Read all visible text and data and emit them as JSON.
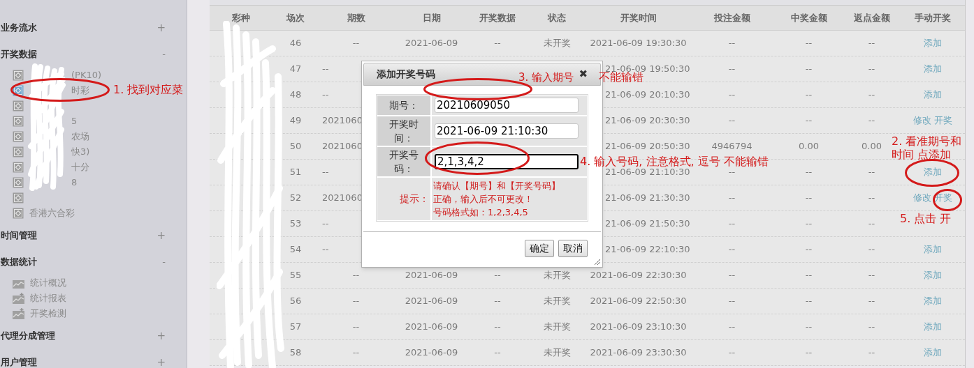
{
  "sidebar": {
    "groups": [
      {
        "title": "业务流水",
        "expanded": false,
        "toggle": "+"
      },
      {
        "title": "开奖数据",
        "expanded": true,
        "toggle": "-",
        "items": [
          {
            "label": "(PK10)",
            "selected": false,
            "kind": "redacted"
          },
          {
            "label": "时彩",
            "selected": true,
            "kind": "redacted"
          },
          {
            "selected": false,
            "kind": "redacted"
          },
          {
            "label": "5",
            "selected": false,
            "kind": "redacted"
          },
          {
            "label": "农场",
            "selected": false,
            "kind": "redacted"
          },
          {
            "label": "快3)",
            "selected": false,
            "kind": "redacted"
          },
          {
            "label": "十分",
            "selected": false,
            "kind": "redacted"
          },
          {
            "label": "8",
            "selected": false,
            "kind": "redacted"
          },
          {
            "selected": false,
            "kind": "redacted"
          },
          {
            "label": "香港六合彩",
            "selected": false,
            "kind": "lottery"
          }
        ]
      },
      {
        "title": "时间管理",
        "expanded": false,
        "toggle": "+"
      },
      {
        "title": "数据统计",
        "expanded": true,
        "toggle": "-",
        "items": [
          {
            "label": "统计概况",
            "selected": false,
            "kind": "chart"
          },
          {
            "label": "统计报表",
            "selected": false,
            "kind": "chart-plus"
          },
          {
            "label": "开奖检测",
            "selected": false,
            "kind": "chart-plus"
          }
        ]
      },
      {
        "title": "代理分成管理",
        "expanded": false,
        "toggle": "+"
      },
      {
        "title": "用户管理",
        "expanded": false,
        "toggle": "+"
      }
    ]
  },
  "table": {
    "columns": [
      "彩种",
      "场次",
      "期数",
      "日期",
      "开奖数据",
      "状态",
      "开奖时间",
      "投注金额",
      "中奖金额",
      "返点金额",
      "手动开奖"
    ],
    "rows": [
      {
        "round": "46",
        "period": "--",
        "date": "2021-06-09",
        "result": "--",
        "status": "未开奖",
        "time": "2021-06-09 19:30:30",
        "bet": "--",
        "win": "--",
        "rebate": "--",
        "actions": [
          "添加"
        ],
        "covered": false
      },
      {
        "round": "47",
        "period": "--",
        "time": "21-06-09 19:50:30",
        "bet": "--",
        "win": "--",
        "rebate": "--",
        "actions": [
          "添加"
        ],
        "covered": true
      },
      {
        "round": "48",
        "period": "--",
        "time": "21-06-09 20:10:30",
        "bet": "--",
        "win": "--",
        "rebate": "--",
        "actions": [
          "添加"
        ],
        "covered": true
      },
      {
        "round": "49",
        "period": "2021060",
        "time": "21-06-09 20:30:30",
        "bet": "--",
        "win": "--",
        "rebate": "--",
        "actions": [
          "修改",
          "开奖"
        ],
        "covered": true
      },
      {
        "round": "50",
        "period": "2021060",
        "time": "21-06-09 20:50:30",
        "bet": "4946794",
        "win": "0.00",
        "rebate": "0.00",
        "actions": [],
        "covered": true
      },
      {
        "round": "51",
        "period": "--",
        "time": "21-06-09 21:10:30",
        "bet": "--",
        "win": "--",
        "rebate": "--",
        "actions": [
          "添加"
        ],
        "covered": true
      },
      {
        "round": "52",
        "period": "2021060",
        "time": "21-06-09 21:30:30",
        "bet": "--",
        "win": "--",
        "rebate": "--",
        "actions": [
          "修改",
          "开奖"
        ],
        "covered": true
      },
      {
        "round": "53",
        "period": "--",
        "time": "21-06-09 21:50:30",
        "bet": "--",
        "win": "--",
        "rebate": "--",
        "actions": [],
        "covered": true
      },
      {
        "round": "54",
        "period": "--",
        "time": "21-06-09 22:10:30",
        "bet": "--",
        "win": "--",
        "rebate": "--",
        "actions": [
          "添加"
        ],
        "covered": true
      },
      {
        "round": "55",
        "period": "--",
        "date": "2021-06-09",
        "result": "--",
        "status": "未开奖",
        "time": "2021-06-09 22:30:30",
        "bet": "--",
        "win": "--",
        "rebate": "--",
        "actions": [
          "添加"
        ],
        "covered": false
      },
      {
        "round": "56",
        "period": "--",
        "date": "2021-06-09",
        "result": "--",
        "status": "未开奖",
        "time": "2021-06-09 22:50:30",
        "bet": "--",
        "win": "--",
        "rebate": "--",
        "actions": [
          "添加"
        ],
        "covered": false
      },
      {
        "round": "57",
        "period": "--",
        "date": "2021-06-09",
        "result": "--",
        "status": "未开奖",
        "time": "2021-06-09 23:10:30",
        "bet": "--",
        "win": "--",
        "rebate": "--",
        "actions": [
          "添加"
        ],
        "covered": false
      },
      {
        "round": "58",
        "period": "--",
        "date": "2021-06-09",
        "result": "--",
        "status": "未开奖",
        "time": "2021-06-09 23:30:30",
        "bet": "--",
        "win": "--",
        "rebate": "--",
        "actions": [
          "添加"
        ],
        "covered": false
      }
    ]
  },
  "dialog": {
    "title": "添加开奖号码",
    "close": "✖",
    "fields": [
      {
        "label": "期号：",
        "value": "20210609050",
        "focused": false
      },
      {
        "label": "开奖时间：",
        "value": "2021-06-09 21:10:30",
        "focused": false
      },
      {
        "label": "开奖号码：",
        "value": "2,1,3,4,2",
        "focused": true
      }
    ],
    "hint": {
      "label": "提示：",
      "lines": [
        "请确认【期号】和【开奖号码】",
        "正确，输入后不可更改！",
        "号码格式如：1,2,3,4,5"
      ]
    },
    "buttons": [
      "确定",
      "取消"
    ]
  },
  "annotations": [
    "1. 找到对应菜",
    "2. 看准期号和时间 点添加",
    "3. 输入期号",
    "不能输错",
    "4. 输入号码, 注意格式, 逗号  不能输错",
    "5. 点击  开"
  ]
}
